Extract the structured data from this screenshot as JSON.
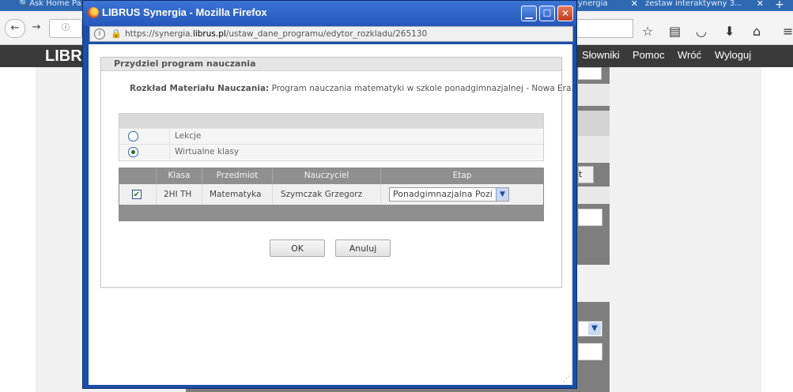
{
  "background": {
    "tabs": [
      {
        "label": "Ask Home Pa"
      },
      {
        "label": "ynergia"
      },
      {
        "label": "zestaw interaktywny 3..."
      }
    ],
    "menu": [
      "Słowniki",
      "Pomoc",
      "Wróć",
      "Wyloguj"
    ],
    "logo": "LIBR",
    "partial_button": "t"
  },
  "popup": {
    "title": "LIBRUS Synergia - Mozilla Firefox",
    "url_prefix": "https://synergia.",
    "url_domain": "librus.pl",
    "url_path": "/ustaw_dane_programu/edytor_rozkladu/265130",
    "dialog": {
      "title": "Przydziel program nauczania",
      "plan_label": "Rozkład Materiału Nauczania:",
      "plan_value": "Program nauczania matematyki w szkole ponadgimnazjalnej - Nowa Era.",
      "options": [
        {
          "label": "Lekcje",
          "checked": false
        },
        {
          "label": "Wirtualne klasy",
          "checked": true
        }
      ],
      "table": {
        "headers": [
          "Klasa",
          "Przedmiot",
          "Nauczyciel",
          "Etap"
        ],
        "rows": [
          {
            "checked": true,
            "klasa": "2HI TH",
            "przedmiot": "Matematyka",
            "nauczyciel": "Szymczak Grzegorz",
            "etap": "Ponadgimnazjalna Pozi"
          }
        ]
      },
      "ok_label": "OK",
      "cancel_label": "Anuluj"
    }
  }
}
